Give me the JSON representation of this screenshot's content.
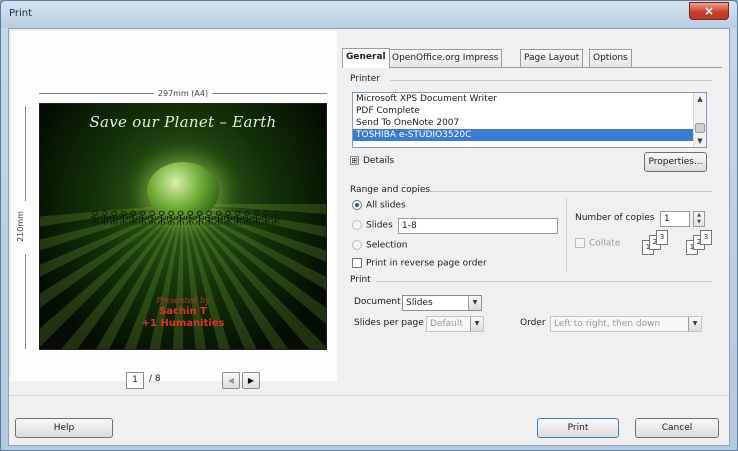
{
  "window": {
    "title": "Print",
    "close_symbol": "×"
  },
  "preview": {
    "width_label": "297mm (A4)",
    "height_label": "210mm",
    "slide": {
      "title": "Save our Planet – Earth",
      "people": "ꆜꆜꆜꆜꆜꆜꆜꆜꆜꆜꆜꆜꆜꆜꆜꆜꆜꆜꆜꆜ",
      "credit_line_1": "Presented by",
      "credit_line_2": "Sachin T",
      "credit_line_3": "+1 Humanities"
    },
    "page_current": "1",
    "page_total": "/ 8",
    "prev_symbol": "◀",
    "next_symbol": "▶"
  },
  "tabs": [
    "General",
    "OpenOffice.org Impress",
    "Page Layout",
    "Options"
  ],
  "printer": {
    "section_label": "Printer",
    "items": [
      "Microsoft XPS Document Writer",
      "PDF Complete",
      "Send To OneNote 2007",
      "TOSHIBA e-STUDIO3520C"
    ],
    "selected_index": 3,
    "details_label": "Details",
    "details_symbol": "⊞",
    "properties_label": "Properties..."
  },
  "range": {
    "section_label": "Range and copies",
    "all_slides": "All slides",
    "slides": "Slides",
    "slides_value": "1-8",
    "selection": "Selection",
    "reverse": "Print in reverse page order",
    "copies_label": "Number of copies",
    "copies_value": "1",
    "collate_label": "Collate"
  },
  "print_section": {
    "section_label": "Print",
    "document_label": "Document",
    "document_value": "Slides",
    "slides_per_page_label": "Slides per page",
    "slides_per_page_value": "Default",
    "order_label": "Order",
    "order_value": "Left to right, then down"
  },
  "buttons": {
    "help": "Help",
    "print": "Print",
    "cancel": "Cancel"
  },
  "colors": {
    "selection": "#3a7bd5",
    "close_button": "#c9412a",
    "slide_text_red": "#e0312a"
  }
}
